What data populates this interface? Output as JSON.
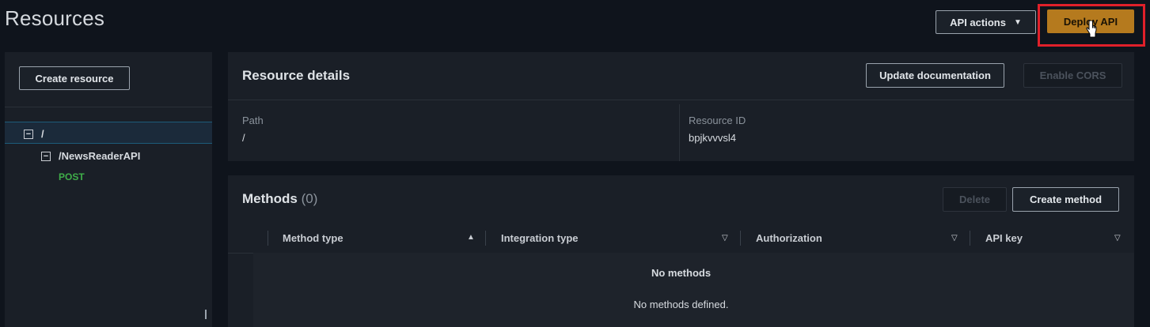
{
  "header": {
    "title": "Resources",
    "api_actions_label": "API actions",
    "deploy_api_label": "Deploy API",
    "highlight_color": "#e0202a"
  },
  "sidebar": {
    "create_resource_label": "Create resource",
    "tree": [
      {
        "label": "/",
        "icon": "collapse-icon",
        "selected": true
      },
      {
        "label": "/NewsReaderAPI",
        "icon": "collapse-icon",
        "selected": false
      },
      {
        "label": "POST",
        "type": "method"
      }
    ]
  },
  "resource_details": {
    "title": "Resource details",
    "update_documentation_label": "Update documentation",
    "enable_cors_label": "Enable CORS",
    "path_label": "Path",
    "path_value": "/",
    "resource_id_label": "Resource ID",
    "resource_id_value": "bpjkvvvsl4"
  },
  "methods": {
    "title": "Methods",
    "count": "(0)",
    "delete_label": "Delete",
    "create_method_label": "Create method",
    "columns": [
      {
        "label": "Method type",
        "sort": "ascending"
      },
      {
        "label": "Integration type",
        "sort": "none"
      },
      {
        "label": "Authorization",
        "sort": "none"
      },
      {
        "label": "API key",
        "sort": "none"
      }
    ],
    "empty_title": "No methods",
    "empty_description": "No methods defined."
  },
  "colors": {
    "accent": "#b57a1e",
    "method_post": "#3fae49",
    "background": "#0f141c",
    "panel": "#1a1f27"
  }
}
